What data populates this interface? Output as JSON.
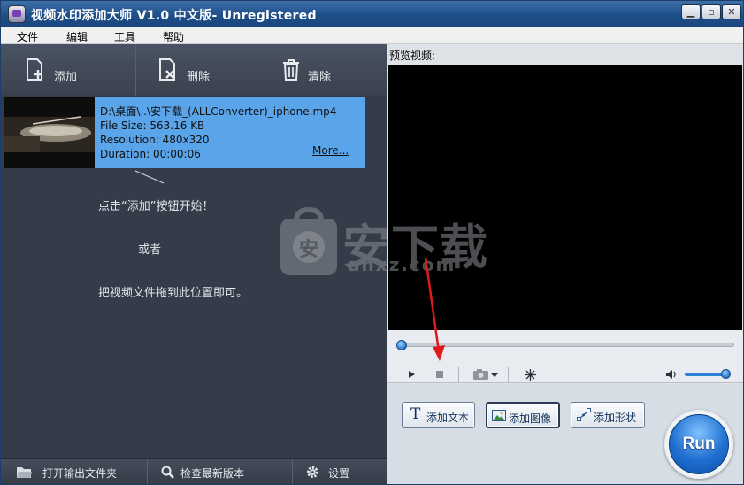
{
  "window": {
    "title": "视频水印添加大师 V1.0 中文版- Unregistered",
    "minimize_icon": "minimize-icon",
    "maximize_icon": "maximize-icon",
    "close_icon": "close-icon"
  },
  "menu": {
    "items": [
      "文件",
      "编辑",
      "工具",
      "帮助"
    ]
  },
  "toolbar": {
    "add_label": "添加",
    "delete_label": "删除",
    "clear_label": "清除"
  },
  "file_item": {
    "path": "D:\\桌面\\..\\安下载_(ALLConverter)_iphone.mp4",
    "size": "File Size: 563.16 KB",
    "resolution": "Resolution: 480x320",
    "duration": "Duration: 00:00:06",
    "more_label": "More..."
  },
  "hints": {
    "line1": "点击“添加”按钮开始！",
    "line2": "或者",
    "line3": "把视频文件拖到此位置即可。"
  },
  "statusbar": {
    "open_output_label": "打开输出文件夹",
    "check_update_label": "检查最新版本",
    "settings_label": "设置"
  },
  "preview": {
    "label": "预览视频:"
  },
  "actions": {
    "add_text_label": "添加文本",
    "add_image_label": "添加图像",
    "add_shape_label": "添加形状",
    "run_label": "Run"
  },
  "watermark": {
    "text": "安下载",
    "sub": "anxz.com",
    "badge": "安"
  },
  "colors": {
    "accent": "#5aa4ea",
    "annotation_arrow": "#e0191b"
  }
}
